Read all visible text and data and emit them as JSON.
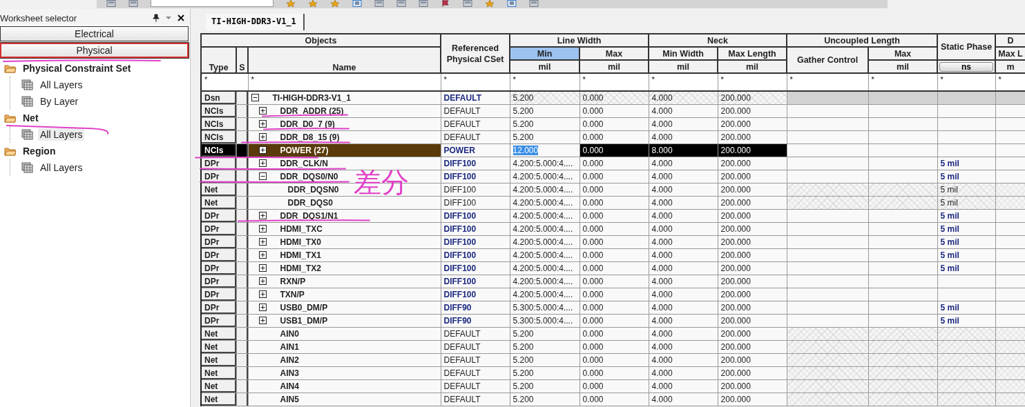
{
  "worksheet_selector": {
    "title": "Worksheet selector",
    "categories": [
      {
        "label": "Electrical",
        "selected": false
      },
      {
        "label": "Physical",
        "selected": true
      }
    ],
    "tree": [
      {
        "label": "Physical Constraint Set",
        "kind": "folder",
        "selected": false,
        "children": [
          {
            "label": "All Layers",
            "kind": "sheet",
            "selected": false
          },
          {
            "label": "By Layer",
            "kind": "sheet",
            "selected": false
          }
        ]
      },
      {
        "label": "Net",
        "kind": "folder",
        "selected": false,
        "children": [
          {
            "label": "All Layers",
            "kind": "sheet",
            "selected": true
          }
        ]
      },
      {
        "label": "Region",
        "kind": "folder",
        "selected": false,
        "children": [
          {
            "label": "All Layers",
            "kind": "sheet",
            "selected": false
          }
        ]
      }
    ]
  },
  "tab": {
    "label": "TI-HIGH-DDR3-V1_1"
  },
  "table": {
    "header": {
      "objects": "Objects",
      "type": "Type",
      "s": "S",
      "name": "Name",
      "cset": "Referenced Physical CSet",
      "groups": [
        {
          "label": "Line Width",
          "kind": "group",
          "columns": [
            {
              "label": "Min",
              "unit": "mil",
              "kind": "unit",
              "selected": true
            },
            {
              "label": "Max",
              "unit": "mil",
              "kind": "unit",
              "selected": false
            }
          ]
        },
        {
          "label": "Neck",
          "kind": "group",
          "columns": [
            {
              "label": "Min Width",
              "unit": "mil",
              "kind": "unit",
              "selected": false
            },
            {
              "label": "Max Length",
              "unit": "mil",
              "kind": "unit",
              "selected": false
            }
          ]
        },
        {
          "label": "Uncoupled Length",
          "kind": "group",
          "columns": [
            {
              "label": "Gather Control",
              "kind": "tall",
              "selected": false
            },
            {
              "label": "Max",
              "unit": "mil",
              "kind": "unit",
              "selected": false
            }
          ]
        },
        {
          "label": "Static Phase",
          "kind": "single",
          "unit": "ns"
        },
        {
          "label": "D",
          "kind": "group",
          "columns": [
            {
              "label": "Max L",
              "unit": "m",
              "kind": "unit",
              "selected": false
            }
          ]
        }
      ]
    },
    "filters": [
      "*",
      "*",
      "*",
      "*",
      "*",
      "*",
      "*",
      "*",
      "*",
      "*",
      "*"
    ],
    "rows": [
      {
        "type": "Dsn",
        "name": "TI-HIGH-DDR3-V1_1",
        "expandable": true,
        "expanded": true,
        "selected": false,
        "editing": false,
        "cset": {
          "text": "DEFAULT",
          "inherited": false
        },
        "values": [
          "5.200",
          "0.000",
          "4.000",
          "200.000"
        ],
        "values_hatched": true,
        "tail_hatched": false,
        "tail_disabled": true,
        "children": [
          {
            "type": "NCls",
            "name": "DDR_ADDR (25)",
            "expandable": true,
            "expanded": false,
            "selected": false,
            "editing": false,
            "cset": {
              "text": "DEFAULT",
              "inherited": true
            },
            "values": [
              "5.200",
              "0.000",
              "4.000",
              "200.000"
            ],
            "values_hatched": false,
            "tail_hatched": false,
            "tail_disabled": false
          },
          {
            "type": "NCls",
            "name": "DDR_D0_7 (9)",
            "expandable": true,
            "expanded": false,
            "selected": false,
            "editing": false,
            "cset": {
              "text": "DEFAULT",
              "inherited": true
            },
            "values": [
              "5.200",
              "0.000",
              "4.000",
              "200.000"
            ],
            "values_hatched": false,
            "tail_hatched": false,
            "tail_disabled": false
          },
          {
            "type": "NCls",
            "name": "DDR_D8_15 (9)",
            "expandable": true,
            "expanded": false,
            "selected": false,
            "editing": false,
            "cset": {
              "text": "DEFAULT",
              "inherited": true
            },
            "values": [
              "5.200",
              "0.000",
              "4.000",
              "200.000"
            ],
            "values_hatched": false,
            "tail_hatched": false,
            "tail_disabled": false
          },
          {
            "type": "NCls",
            "name": "POWER (27)",
            "expandable": true,
            "expanded": false,
            "selected": true,
            "editing": true,
            "cset": {
              "text": "POWER",
              "inherited": false
            },
            "values": [
              "12.000",
              "0.000",
              "8.000",
              "200.000"
            ],
            "values_hatched": false,
            "tail_hatched": false,
            "tail_disabled": false
          },
          {
            "type": "DPr",
            "name": "DDR_CLK/N",
            "expandable": true,
            "expanded": false,
            "selected": false,
            "editing": false,
            "cset": {
              "text": "DIFF100",
              "inherited": false
            },
            "values": [
              "4.200:5.000:4....",
              "0.000",
              "4.000",
              "200.000"
            ],
            "values_hatched": false,
            "tail_hatched": false,
            "tail_disabled": false,
            "static_phase": {
              "text": "5 mil",
              "inherited": false
            }
          },
          {
            "type": "DPr",
            "name": "DDR_DQS0/N0",
            "expandable": true,
            "expanded": true,
            "selected": false,
            "editing": false,
            "cset": {
              "text": "DIFF100",
              "inherited": false
            },
            "values": [
              "4.200:5.000:4....",
              "0.000",
              "4.000",
              "200.000"
            ],
            "values_hatched": false,
            "tail_hatched": false,
            "tail_disabled": false,
            "static_phase": {
              "text": "5 mil",
              "inherited": false
            },
            "children": [
              {
                "type": "Net",
                "name": "DDR_DQSN0",
                "expandable": false,
                "selected": false,
                "editing": false,
                "cset": {
                  "text": "DIFF100",
                  "inherited": true
                },
                "values": [
                  "4.200:5.000:4....",
                  "0.000",
                  "4.000",
                  "200.000"
                ],
                "values_hatched": false,
                "tail_hatched": true,
                "tail_disabled": false,
                "static_phase": {
                  "text": "5 mil",
                  "inherited": true
                }
              },
              {
                "type": "Net",
                "name": "DDR_DQS0",
                "expandable": false,
                "selected": false,
                "editing": false,
                "cset": {
                  "text": "DIFF100",
                  "inherited": true
                },
                "values": [
                  "4.200:5.000:4....",
                  "0.000",
                  "4.000",
                  "200.000"
                ],
                "values_hatched": false,
                "tail_hatched": true,
                "tail_disabled": false,
                "static_phase": {
                  "text": "5 mil",
                  "inherited": true
                }
              }
            ]
          },
          {
            "type": "DPr",
            "name": "DDR_DQS1/N1",
            "expandable": true,
            "expanded": false,
            "selected": false,
            "editing": false,
            "cset": {
              "text": "DIFF100",
              "inherited": false
            },
            "values": [
              "4.200:5.000:4....",
              "0.000",
              "4.000",
              "200.000"
            ],
            "values_hatched": false,
            "tail_hatched": false,
            "tail_disabled": false,
            "static_phase": {
              "text": "5 mil",
              "inherited": false
            }
          },
          {
            "type": "DPr",
            "name": "HDMI_TXC",
            "expandable": true,
            "expanded": false,
            "selected": false,
            "editing": false,
            "cset": {
              "text": "DIFF100",
              "inherited": false
            },
            "values": [
              "4.200:5.000:4....",
              "0.000",
              "4.000",
              "200.000"
            ],
            "values_hatched": false,
            "tail_hatched": false,
            "tail_disabled": false,
            "static_phase": {
              "text": "5 mil",
              "inherited": false
            }
          },
          {
            "type": "DPr",
            "name": "HDMI_TX0",
            "expandable": true,
            "expanded": false,
            "selected": false,
            "editing": false,
            "cset": {
              "text": "DIFF100",
              "inherited": false
            },
            "values": [
              "4.200:5.000:4....",
              "0.000",
              "4.000",
              "200.000"
            ],
            "values_hatched": false,
            "tail_hatched": false,
            "tail_disabled": false,
            "static_phase": {
              "text": "5 mil",
              "inherited": false
            }
          },
          {
            "type": "DPr",
            "name": "HDMI_TX1",
            "expandable": true,
            "expanded": false,
            "selected": false,
            "editing": false,
            "cset": {
              "text": "DIFF100",
              "inherited": false
            },
            "values": [
              "4.200:5.000:4....",
              "0.000",
              "4.000",
              "200.000"
            ],
            "values_hatched": false,
            "tail_hatched": false,
            "tail_disabled": false,
            "static_phase": {
              "text": "5 mil",
              "inherited": false
            }
          },
          {
            "type": "DPr",
            "name": "HDMI_TX2",
            "expandable": true,
            "expanded": false,
            "selected": false,
            "editing": false,
            "cset": {
              "text": "DIFF100",
              "inherited": false
            },
            "values": [
              "4.200:5.000:4....",
              "0.000",
              "4.000",
              "200.000"
            ],
            "values_hatched": false,
            "tail_hatched": false,
            "tail_disabled": false,
            "static_phase": {
              "text": "5 mil",
              "inherited": false
            }
          },
          {
            "type": "DPr",
            "name": "RXN/P",
            "expandable": true,
            "expanded": false,
            "selected": false,
            "editing": false,
            "cset": {
              "text": "DIFF100",
              "inherited": false
            },
            "values": [
              "4.200:5.000:4....",
              "0.000",
              "4.000",
              "200.000"
            ],
            "values_hatched": false,
            "tail_hatched": false,
            "tail_disabled": false
          },
          {
            "type": "DPr",
            "name": "TXN/P",
            "expandable": true,
            "expanded": false,
            "selected": false,
            "editing": false,
            "cset": {
              "text": "DIFF100",
              "inherited": false
            },
            "values": [
              "4.200:5.000:4....",
              "0.000",
              "4.000",
              "200.000"
            ],
            "values_hatched": false,
            "tail_hatched": false,
            "tail_disabled": false
          },
          {
            "type": "DPr",
            "name": "USB0_DM/P",
            "expandable": true,
            "expanded": false,
            "selected": false,
            "editing": false,
            "cset": {
              "text": "DIFF90",
              "inherited": false
            },
            "values": [
              "5.300:5.000:4....",
              "0.000",
              "4.000",
              "200.000"
            ],
            "values_hatched": false,
            "tail_hatched": false,
            "tail_disabled": false,
            "static_phase": {
              "text": "5 mil",
              "inherited": false
            }
          },
          {
            "type": "DPr",
            "name": "USB1_DM/P",
            "expandable": true,
            "expanded": false,
            "selected": false,
            "editing": false,
            "cset": {
              "text": "DIFF90",
              "inherited": false
            },
            "values": [
              "5.300:5.000:4....",
              "0.000",
              "4.000",
              "200.000"
            ],
            "values_hatched": false,
            "tail_hatched": false,
            "tail_disabled": false,
            "static_phase": {
              "text": "5 mil",
              "inherited": false
            }
          },
          {
            "type": "Net",
            "name": "AIN0",
            "expandable": false,
            "selected": false,
            "editing": false,
            "cset": {
              "text": "DEFAULT",
              "inherited": true
            },
            "values": [
              "5.200",
              "0.000",
              "4.000",
              "200.000"
            ],
            "values_hatched": false,
            "tail_hatched": true,
            "tail_disabled": false
          },
          {
            "type": "Net",
            "name": "AIN1",
            "expandable": false,
            "selected": false,
            "editing": false,
            "cset": {
              "text": "DEFAULT",
              "inherited": true
            },
            "values": [
              "5.200",
              "0.000",
              "4.000",
              "200.000"
            ],
            "values_hatched": false,
            "tail_hatched": true,
            "tail_disabled": false
          },
          {
            "type": "Net",
            "name": "AIN2",
            "expandable": false,
            "selected": false,
            "editing": false,
            "cset": {
              "text": "DEFAULT",
              "inherited": true
            },
            "values": [
              "5.200",
              "0.000",
              "4.000",
              "200.000"
            ],
            "values_hatched": false,
            "tail_hatched": true,
            "tail_disabled": false
          },
          {
            "type": "Net",
            "name": "AIN3",
            "expandable": false,
            "selected": false,
            "editing": false,
            "cset": {
              "text": "DEFAULT",
              "inherited": true
            },
            "values": [
              "5.200",
              "0.000",
              "4.000",
              "200.000"
            ],
            "values_hatched": false,
            "tail_hatched": true,
            "tail_disabled": false
          },
          {
            "type": "Net",
            "name": "AIN4",
            "expandable": false,
            "selected": false,
            "editing": false,
            "cset": {
              "text": "DEFAULT",
              "inherited": true
            },
            "values": [
              "5.200",
              "0.000",
              "4.000",
              "200.000"
            ],
            "values_hatched": false,
            "tail_hatched": true,
            "tail_disabled": false
          },
          {
            "type": "Net",
            "name": "AIN5",
            "expandable": false,
            "selected": false,
            "editing": false,
            "cset": {
              "text": "DEFAULT",
              "inherited": true
            },
            "values": [
              "5.200",
              "0.000",
              "4.000",
              "200.000"
            ],
            "values_hatched": false,
            "tail_hatched": true,
            "tail_disabled": false
          }
        ]
      }
    ]
  },
  "annotation": {
    "text": "差分"
  }
}
